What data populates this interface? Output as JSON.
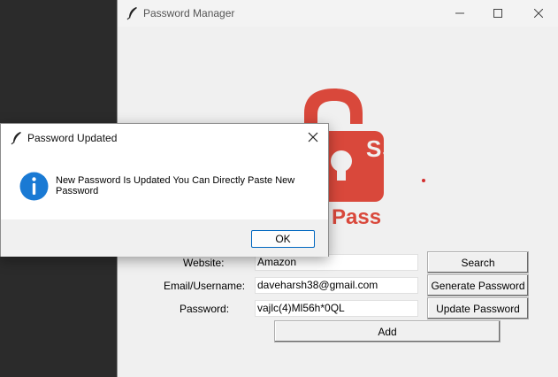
{
  "main_window": {
    "title": "Password Manager",
    "logo": {
      "text": "Pass",
      "color": "#d9483b"
    },
    "form": {
      "website_label": "Website:",
      "website_value": "Amazon",
      "email_label": "Email/Username:",
      "email_value": "daveharsh38@gmail.com",
      "password_label": "Password:",
      "password_value": "vajlc(4)Ml56h*0QL"
    },
    "buttons": {
      "search": "Search",
      "generate": "Generate Password",
      "update": "Update Password",
      "add": "Add"
    }
  },
  "dialog": {
    "title": "Password Updated",
    "message": "New Password Is Updated You Can Directly Paste New Password",
    "ok_label": "OK",
    "icon": "info-icon"
  },
  "colors": {
    "accent": "#0067c0",
    "info": "#1a7ad4",
    "brand_red": "#d9483b"
  }
}
